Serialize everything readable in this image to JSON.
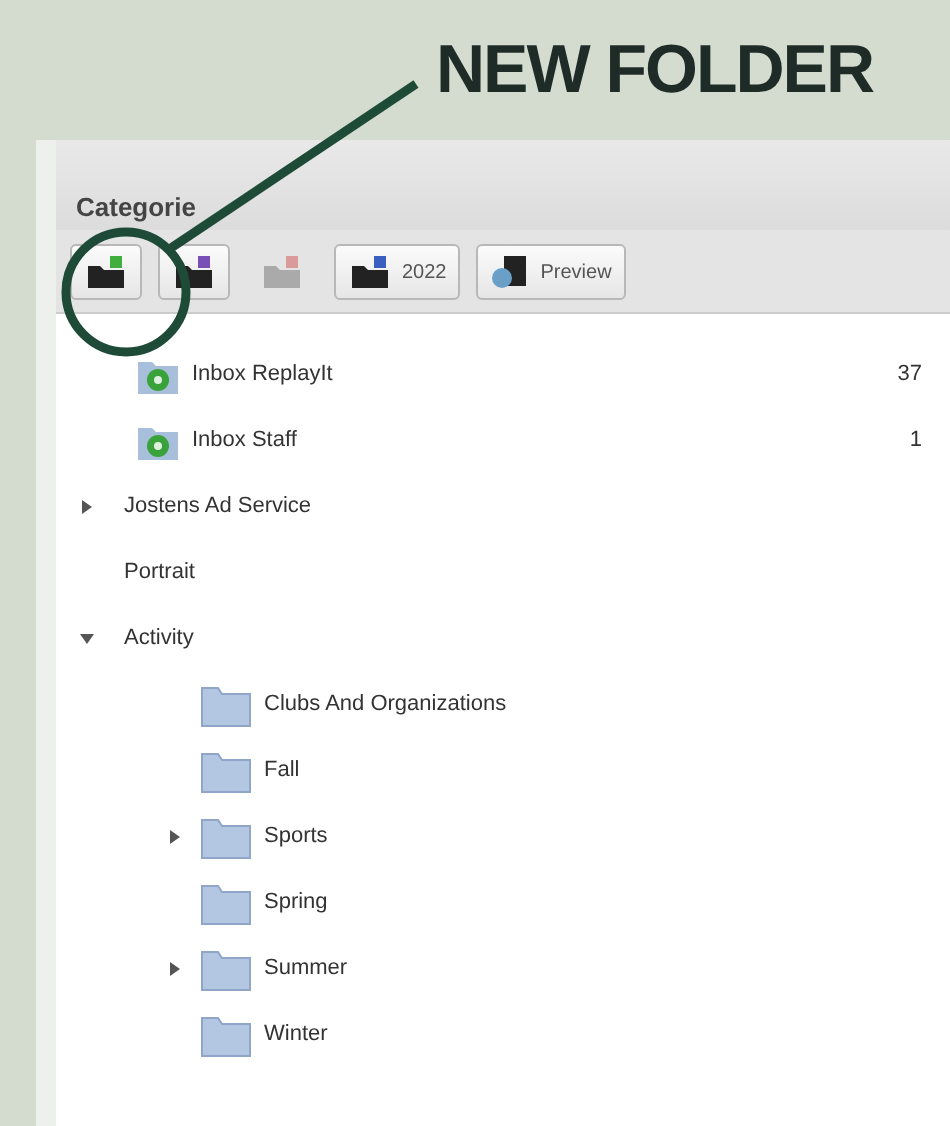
{
  "annotation": {
    "label": "NEW FOLDER"
  },
  "panel": {
    "title": "Categorie"
  },
  "toolbar": [
    {
      "kind": "add",
      "disabled": false
    },
    {
      "kind": "edit",
      "disabled": false
    },
    {
      "kind": "remove",
      "disabled": true
    },
    {
      "kind": "year",
      "label": "2022",
      "disabled": false
    },
    {
      "kind": "preview",
      "label": "Preview",
      "disabled": false
    }
  ],
  "tree": [
    {
      "label": "Inbox ReplayIt",
      "kind": "inbox",
      "count": "37"
    },
    {
      "label": "Inbox Staff",
      "kind": "inbox",
      "count": "1"
    },
    {
      "label": "Jostens Ad Service",
      "kind": "plain",
      "expanded": false
    },
    {
      "label": "Portrait",
      "kind": "plain"
    },
    {
      "label": "Activity",
      "kind": "plain",
      "expanded": true,
      "children": [
        {
          "label": "Clubs And Organizations",
          "kind": "folder"
        },
        {
          "label": "Fall",
          "kind": "folder"
        },
        {
          "label": "Sports",
          "kind": "folder",
          "expanded": false
        },
        {
          "label": "Spring",
          "kind": "folder"
        },
        {
          "label": "Summer",
          "kind": "folder",
          "expanded": false
        },
        {
          "label": "Winter",
          "kind": "folder"
        }
      ]
    }
  ]
}
